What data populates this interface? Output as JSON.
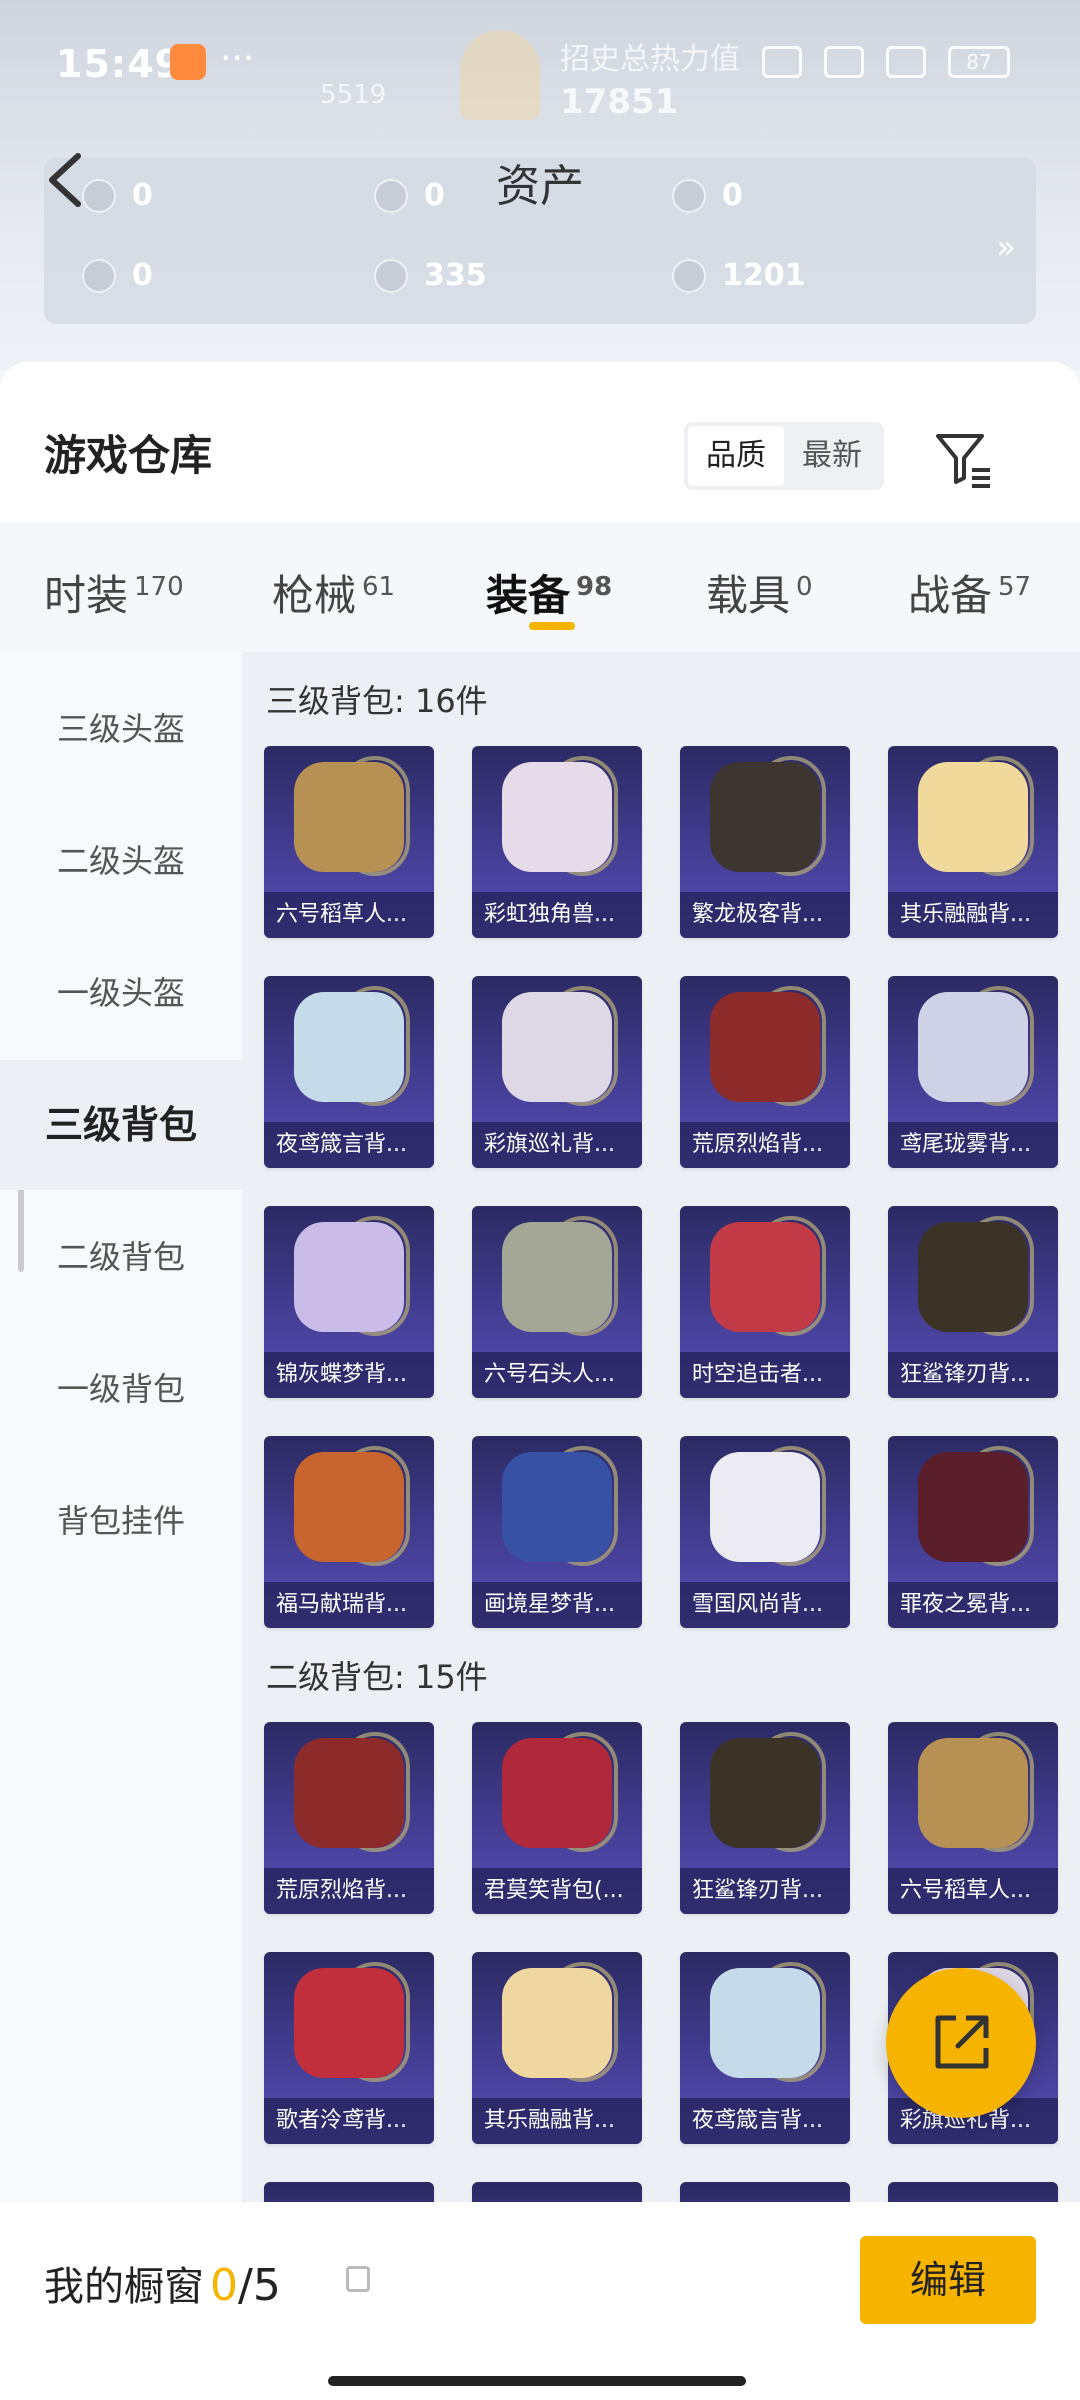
{
  "status_bar": {
    "time": "15:49",
    "more": "···",
    "battery": "87"
  },
  "header": {
    "title": "资产",
    "score_label": "招史总热力值",
    "score_value": "17851",
    "small_value": "5519",
    "assets": [
      {
        "value": "0"
      },
      {
        "value": "0"
      },
      {
        "value": "0"
      },
      {
        "value": "0"
      },
      {
        "value": "335"
      },
      {
        "value": "1201"
      }
    ]
  },
  "warehouse": {
    "title": "游戏仓库",
    "sort": {
      "quality": "品质",
      "latest": "最新"
    }
  },
  "tabs": [
    {
      "label": "时装",
      "count": "170"
    },
    {
      "label": "枪械",
      "count": "61"
    },
    {
      "label": "装备",
      "count": "98"
    },
    {
      "label": "载具",
      "count": "0"
    },
    {
      "label": "战备",
      "count": "57"
    }
  ],
  "sidebar": [
    "三级头盔",
    "二级头盔",
    "一级头盔",
    "三级背包",
    "二级背包",
    "一级背包",
    "背包挂件"
  ],
  "sections": [
    {
      "title": "三级背包: 16件",
      "items": [
        "六号稻草人...",
        "彩虹独角兽...",
        "繁龙极客背...",
        "其乐融融背...",
        "夜鸢箴言背...",
        "彩旗巡礼背...",
        "荒原烈焰背...",
        "鸢尾珑雾背...",
        "锦灰蝶梦背...",
        "六号石头人...",
        "时空追击者...",
        "狂鲨锋刃背...",
        "福马献瑞背...",
        "画境星梦背...",
        "雪国风尚背...",
        "罪夜之冕背..."
      ]
    },
    {
      "title": "二级背包: 15件",
      "items": [
        "荒原烈焰背...",
        "君莫笑背包(...",
        "狂鲨锋刃背...",
        "六号稻草人...",
        "歌者泠鸢背...",
        "其乐融融背...",
        "夜鸢箴言背...",
        "彩旗巡礼背..."
      ]
    }
  ],
  "bottom": {
    "showcase_label": "我的橱窗",
    "showcase_count": "0",
    "showcase_total": "/5",
    "edit": "编辑"
  },
  "colors": {
    "accent": "#f6b400",
    "card_bg": "#3a3585"
  }
}
